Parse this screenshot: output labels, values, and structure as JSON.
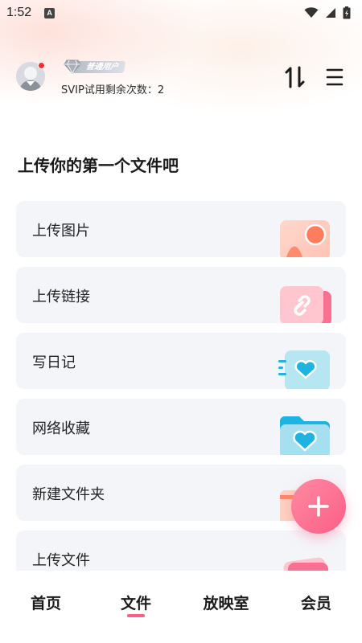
{
  "status_bar": {
    "time": "1:52",
    "notification_letter": "A",
    "icons": [
      "wifi-icon",
      "signal-icon",
      "battery-icon"
    ]
  },
  "header": {
    "avatar_icon": "avatar",
    "badge_label": "普通用户",
    "svip_text": "SVIP试用剩余次数：2",
    "sort_icon": "sort-icon",
    "menu_icon": "menu-icon"
  },
  "section_title": "上传你的第一个文件吧",
  "items": [
    {
      "label": "上传图片",
      "icon": "image-icon"
    },
    {
      "label": "上传链接",
      "icon": "link-icon"
    },
    {
      "label": "写日记",
      "icon": "diary-icon"
    },
    {
      "label": "网络收藏",
      "icon": "folder-heart-icon"
    },
    {
      "label": "新建文件夹",
      "icon": "new-folder-icon"
    },
    {
      "label": "上传文件",
      "icon": "file-icon"
    }
  ],
  "fab_icon": "plus-icon",
  "nav": {
    "items": [
      "首页",
      "文件",
      "放映室",
      "会员"
    ],
    "active": "文件"
  },
  "colors": {
    "accent": "#fb5f86",
    "card_bg": "#f4f5f9"
  }
}
